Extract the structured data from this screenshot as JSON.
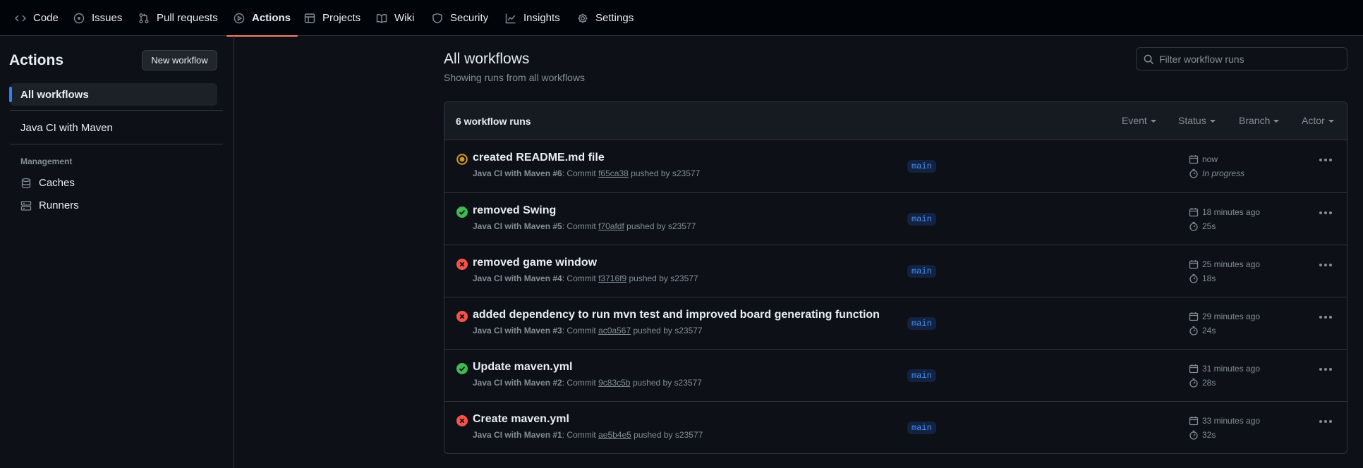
{
  "nav": {
    "tabs": [
      {
        "label": "Code",
        "icon": "code-icon"
      },
      {
        "label": "Issues",
        "icon": "issue-icon"
      },
      {
        "label": "Pull requests",
        "icon": "pull-request-icon"
      },
      {
        "label": "Actions",
        "icon": "play-icon",
        "active": true
      },
      {
        "label": "Projects",
        "icon": "table-icon"
      },
      {
        "label": "Wiki",
        "icon": "book-icon"
      },
      {
        "label": "Security",
        "icon": "shield-icon"
      },
      {
        "label": "Insights",
        "icon": "graph-icon"
      },
      {
        "label": "Settings",
        "icon": "gear-icon"
      }
    ]
  },
  "sidebar": {
    "title": "Actions",
    "new_workflow_label": "New workflow",
    "all_workflows_label": "All workflows",
    "workflows": [
      "Java CI with Maven"
    ],
    "management_label": "Management",
    "management_items": [
      {
        "label": "Caches",
        "icon": "database-icon"
      },
      {
        "label": "Runners",
        "icon": "server-icon"
      }
    ]
  },
  "main": {
    "title": "All workflows",
    "subtitle": "Showing runs from all workflows",
    "filter_placeholder": "Filter workflow runs",
    "runs_count": "6 workflow runs",
    "filters": [
      "Event",
      "Status",
      "Branch",
      "Actor"
    ],
    "runs": [
      {
        "title": "created README.md file",
        "workflow": "Java CI with Maven #6",
        "commit": "f65ca38",
        "actor": "s23577",
        "branch": "main",
        "when": "now",
        "duration": "In progress",
        "status": "in_progress"
      },
      {
        "title": "removed Swing",
        "workflow": "Java CI with Maven #5",
        "commit": "f70afdf",
        "actor": "s23577",
        "branch": "main",
        "when": "18 minutes ago",
        "duration": "25s",
        "status": "success"
      },
      {
        "title": "removed game window",
        "workflow": "Java CI with Maven #4",
        "commit": "f3716f9",
        "actor": "s23577",
        "branch": "main",
        "when": "25 minutes ago",
        "duration": "18s",
        "status": "failure"
      },
      {
        "title": "added dependency to run mvn test and improved board generating function",
        "workflow": "Java CI with Maven #3",
        "commit": "ac0a567",
        "actor": "s23577",
        "branch": "main",
        "when": "29 minutes ago",
        "duration": "24s",
        "status": "failure"
      },
      {
        "title": "Update maven.yml",
        "workflow": "Java CI with Maven #2",
        "commit": "9c83c5b",
        "actor": "s23577",
        "branch": "main",
        "when": "31 minutes ago",
        "duration": "28s",
        "status": "success"
      },
      {
        "title": "Create maven.yml",
        "workflow": "Java CI with Maven #1",
        "commit": "ae5b4e5",
        "actor": "s23577",
        "branch": "main",
        "when": "33 minutes ago",
        "duration": "32s",
        "status": "failure"
      }
    ],
    "commit_word": "Commit",
    "pushed_by_word": "pushed by"
  },
  "colors": {
    "success": "#3fb950",
    "failure": "#f85149",
    "in_progress": "#d29922",
    "accent": "#f78166"
  }
}
